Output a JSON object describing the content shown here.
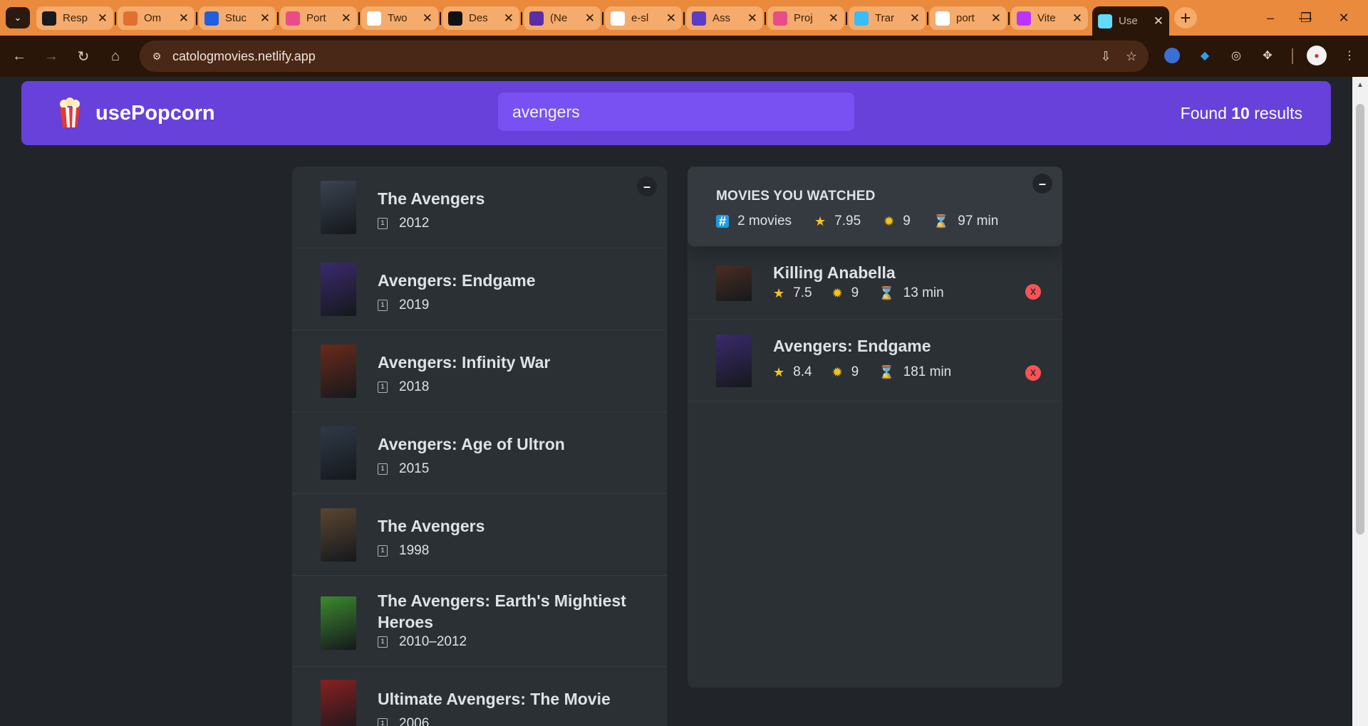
{
  "browser": {
    "tabs": [
      {
        "title": "Resp",
        "icon": "chatgpt-icon",
        "color": "#1a1a1a"
      },
      {
        "title": "Om",
        "icon": "infinity-icon",
        "color": "#e07030"
      },
      {
        "title": "Stuc",
        "icon": "studocu-icon",
        "color": "#1f5fe0"
      },
      {
        "title": "Port",
        "icon": "dribbble-icon",
        "color": "#ea4c89"
      },
      {
        "title": "Two",
        "icon": "briefcase-icon",
        "color": "#ffffff"
      },
      {
        "title": "Des",
        "icon": "is-icon",
        "color": "#111111"
      },
      {
        "title": "(Ne",
        "icon": "news-icon",
        "color": "#5a2ea6"
      },
      {
        "title": "e-sl",
        "icon": "google-icon",
        "color": "#ffffff"
      },
      {
        "title": "Ass",
        "icon": "list-icon",
        "color": "#5b3cc4"
      },
      {
        "title": "Proj",
        "icon": "dribbble-icon",
        "color": "#ea4c89"
      },
      {
        "title": "Trar",
        "icon": "tailwind-icon",
        "color": "#38bdf8"
      },
      {
        "title": "port",
        "icon": "google-icon",
        "color": "#ffffff"
      },
      {
        "title": "Vite",
        "icon": "vite-icon",
        "color": "#bd34fe"
      },
      {
        "title": "Use",
        "icon": "react-icon",
        "color": "#61dafb"
      }
    ],
    "url": "catologmovies.netlify.app"
  },
  "app": {
    "logo_emoji": "🍿",
    "name": "usePopcorn",
    "search_value": "avengers",
    "results_prefix": "Found ",
    "results_count": "10",
    "results_suffix": " results"
  },
  "movies": [
    {
      "title": "The Avengers",
      "year": "2012",
      "poster_color": "#3a4350"
    },
    {
      "title": "Avengers: Endgame",
      "year": "2019",
      "poster_color": "#3a2a6e"
    },
    {
      "title": "Avengers: Infinity War",
      "year": "2018",
      "poster_color": "#6b2a1a"
    },
    {
      "title": "Avengers: Age of Ultron",
      "year": "2015",
      "poster_color": "#2f3a48"
    },
    {
      "title": "The Avengers",
      "year": "1998",
      "poster_color": "#5b4630"
    },
    {
      "title": "The Avengers: Earth's Mightiest Heroes",
      "year": "2010–2012",
      "poster_color": "#3c8a2e"
    },
    {
      "title": "Ultimate Avengers: The Movie",
      "year": "2006",
      "poster_color": "#8a2020"
    }
  ],
  "watched_summary": {
    "heading": "MOVIES YOU WATCHED",
    "count": "2 movies",
    "imdb_avg": "7.95",
    "user_avg": "9",
    "runtime": "97 min"
  },
  "watched": [
    {
      "title": "Killing Anabella",
      "imdb": "7.5",
      "user": "9",
      "runtime": "13 min",
      "poster_color": "#4a2e22",
      "delete_label": "X"
    },
    {
      "title": "Avengers: Endgame",
      "imdb": "8.4",
      "user": "9",
      "runtime": "181 min",
      "poster_color": "#3a2a6e",
      "delete_label": "X"
    }
  ]
}
